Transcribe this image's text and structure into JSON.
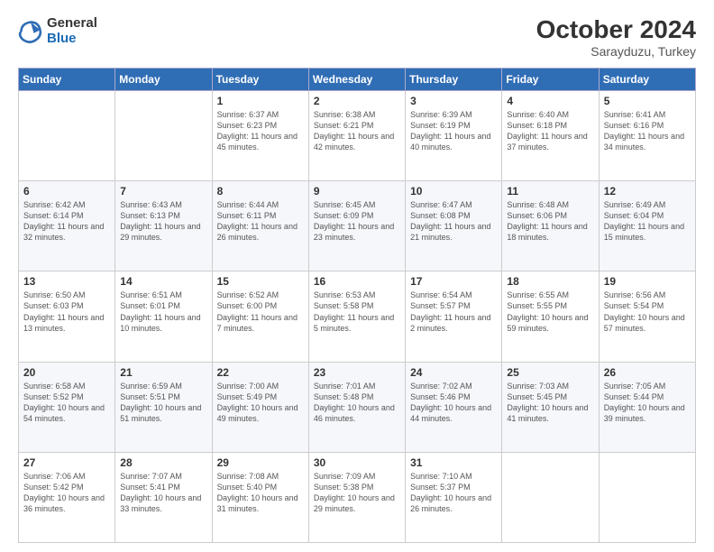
{
  "logo": {
    "general": "General",
    "blue": "Blue"
  },
  "header": {
    "month": "October 2024",
    "location": "Sarayduzu, Turkey"
  },
  "days_of_week": [
    "Sunday",
    "Monday",
    "Tuesday",
    "Wednesday",
    "Thursday",
    "Friday",
    "Saturday"
  ],
  "weeks": [
    [
      {
        "day": null
      },
      {
        "day": null
      },
      {
        "day": 1,
        "sunrise": "6:37 AM",
        "sunset": "6:23 PM",
        "daylight": "11 hours and 45 minutes."
      },
      {
        "day": 2,
        "sunrise": "6:38 AM",
        "sunset": "6:21 PM",
        "daylight": "11 hours and 42 minutes."
      },
      {
        "day": 3,
        "sunrise": "6:39 AM",
        "sunset": "6:19 PM",
        "daylight": "11 hours and 40 minutes."
      },
      {
        "day": 4,
        "sunrise": "6:40 AM",
        "sunset": "6:18 PM",
        "daylight": "11 hours and 37 minutes."
      },
      {
        "day": 5,
        "sunrise": "6:41 AM",
        "sunset": "6:16 PM",
        "daylight": "11 hours and 34 minutes."
      }
    ],
    [
      {
        "day": 6,
        "sunrise": "6:42 AM",
        "sunset": "6:14 PM",
        "daylight": "11 hours and 32 minutes."
      },
      {
        "day": 7,
        "sunrise": "6:43 AM",
        "sunset": "6:13 PM",
        "daylight": "11 hours and 29 minutes."
      },
      {
        "day": 8,
        "sunrise": "6:44 AM",
        "sunset": "6:11 PM",
        "daylight": "11 hours and 26 minutes."
      },
      {
        "day": 9,
        "sunrise": "6:45 AM",
        "sunset": "6:09 PM",
        "daylight": "11 hours and 23 minutes."
      },
      {
        "day": 10,
        "sunrise": "6:47 AM",
        "sunset": "6:08 PM",
        "daylight": "11 hours and 21 minutes."
      },
      {
        "day": 11,
        "sunrise": "6:48 AM",
        "sunset": "6:06 PM",
        "daylight": "11 hours and 18 minutes."
      },
      {
        "day": 12,
        "sunrise": "6:49 AM",
        "sunset": "6:04 PM",
        "daylight": "11 hours and 15 minutes."
      }
    ],
    [
      {
        "day": 13,
        "sunrise": "6:50 AM",
        "sunset": "6:03 PM",
        "daylight": "11 hours and 13 minutes."
      },
      {
        "day": 14,
        "sunrise": "6:51 AM",
        "sunset": "6:01 PM",
        "daylight": "11 hours and 10 minutes."
      },
      {
        "day": 15,
        "sunrise": "6:52 AM",
        "sunset": "6:00 PM",
        "daylight": "11 hours and 7 minutes."
      },
      {
        "day": 16,
        "sunrise": "6:53 AM",
        "sunset": "5:58 PM",
        "daylight": "11 hours and 5 minutes."
      },
      {
        "day": 17,
        "sunrise": "6:54 AM",
        "sunset": "5:57 PM",
        "daylight": "11 hours and 2 minutes."
      },
      {
        "day": 18,
        "sunrise": "6:55 AM",
        "sunset": "5:55 PM",
        "daylight": "10 hours and 59 minutes."
      },
      {
        "day": 19,
        "sunrise": "6:56 AM",
        "sunset": "5:54 PM",
        "daylight": "10 hours and 57 minutes."
      }
    ],
    [
      {
        "day": 20,
        "sunrise": "6:58 AM",
        "sunset": "5:52 PM",
        "daylight": "10 hours and 54 minutes."
      },
      {
        "day": 21,
        "sunrise": "6:59 AM",
        "sunset": "5:51 PM",
        "daylight": "10 hours and 51 minutes."
      },
      {
        "day": 22,
        "sunrise": "7:00 AM",
        "sunset": "5:49 PM",
        "daylight": "10 hours and 49 minutes."
      },
      {
        "day": 23,
        "sunrise": "7:01 AM",
        "sunset": "5:48 PM",
        "daylight": "10 hours and 46 minutes."
      },
      {
        "day": 24,
        "sunrise": "7:02 AM",
        "sunset": "5:46 PM",
        "daylight": "10 hours and 44 minutes."
      },
      {
        "day": 25,
        "sunrise": "7:03 AM",
        "sunset": "5:45 PM",
        "daylight": "10 hours and 41 minutes."
      },
      {
        "day": 26,
        "sunrise": "7:05 AM",
        "sunset": "5:44 PM",
        "daylight": "10 hours and 39 minutes."
      }
    ],
    [
      {
        "day": 27,
        "sunrise": "7:06 AM",
        "sunset": "5:42 PM",
        "daylight": "10 hours and 36 minutes."
      },
      {
        "day": 28,
        "sunrise": "7:07 AM",
        "sunset": "5:41 PM",
        "daylight": "10 hours and 33 minutes."
      },
      {
        "day": 29,
        "sunrise": "7:08 AM",
        "sunset": "5:40 PM",
        "daylight": "10 hours and 31 minutes."
      },
      {
        "day": 30,
        "sunrise": "7:09 AM",
        "sunset": "5:38 PM",
        "daylight": "10 hours and 29 minutes."
      },
      {
        "day": 31,
        "sunrise": "7:10 AM",
        "sunset": "5:37 PM",
        "daylight": "10 hours and 26 minutes."
      },
      {
        "day": null
      },
      {
        "day": null
      }
    ]
  ]
}
